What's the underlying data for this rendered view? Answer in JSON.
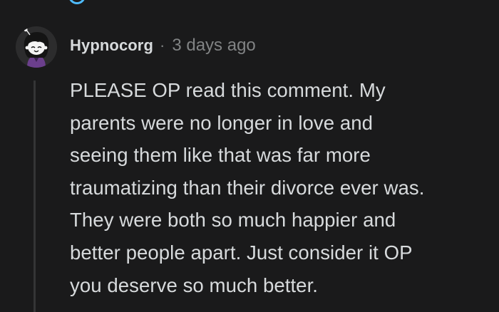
{
  "comment": {
    "username": "Hypnocorg",
    "separator": "·",
    "timestamp": "3 days ago",
    "body_lines": [
      "PLEASE OP read this comment. My",
      "parents were no longer in love and",
      "seeing them like that was far more",
      "traumatizing than their divorce ever was.",
      "They were both so much happier and",
      "better people apart. Just consider it OP",
      "you deserve so much better."
    ]
  },
  "colors": {
    "background": "#1a1a1b",
    "text_primary": "#d7dadc",
    "text_meta": "#818384",
    "thread_line": "#343536",
    "accent": "#4fbcff"
  },
  "icons": {
    "avatar": "snoo-avatar-icon"
  }
}
